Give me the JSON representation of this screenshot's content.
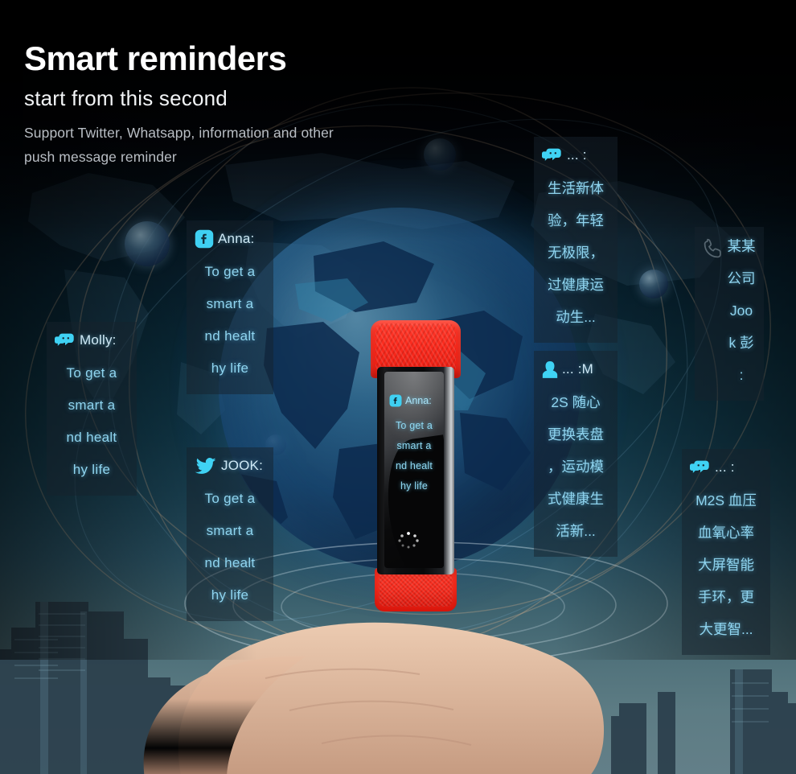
{
  "meta": {
    "accent_cyan": "#4DD6F5",
    "text_cyan": "#8FD4EF",
    "band_red": "#FB2A1D",
    "card_bg": "rgba(22,34,44,0.50)"
  },
  "headline": {
    "title": "Smart reminders",
    "subtitle": "start from this second",
    "description_line1": "Support Twitter, Whatsapp, information and other",
    "description_line2": "push message reminder"
  },
  "device": {
    "screen": {
      "icon": "facebook-icon",
      "sender": "Anna:",
      "lines": [
        "To get a",
        "smart a",
        "nd healt",
        "hy life"
      ],
      "loading_indicator": "dot-spinner"
    }
  },
  "messages": [
    {
      "id": "molly",
      "icon": "chat-bubble-icon",
      "name": "Molly:",
      "lines": [
        "To get a",
        "smart a",
        "nd healt",
        "hy life"
      ]
    },
    {
      "id": "anna",
      "icon": "facebook-icon",
      "name": "Anna:",
      "lines": [
        "To get a",
        "smart a",
        "nd healt",
        "hy life"
      ]
    },
    {
      "id": "jook",
      "icon": "twitter-icon",
      "name": "JOOK:",
      "lines": [
        "To get a",
        "smart a",
        "nd healt",
        "hy life"
      ]
    },
    {
      "id": "cn-top",
      "icon": "chat-bubble-icon",
      "name": "...  :",
      "lines": [
        "生活新体",
        "验，年轻",
        "无极限，",
        "过健康运",
        "动生..."
      ]
    },
    {
      "id": "cn-contact",
      "icon": "contact-person-icon",
      "name": "... :M",
      "lines": [
        "2S 随心",
        "更换表盘",
        "，运动模",
        "式健康生",
        "活新..."
      ]
    },
    {
      "id": "cn-phone",
      "icon": "phone-handset-icon",
      "name": "",
      "lines": [
        "某某",
        "公司",
        "Joo",
        "k 彭",
        ":"
      ]
    },
    {
      "id": "cn-bottom",
      "icon": "chat-bubble-icon",
      "name": "...  :",
      "lines": [
        "M2S 血压",
        "血氧心率",
        "大屏智能",
        "手环，更",
        "大更智..."
      ]
    }
  ]
}
